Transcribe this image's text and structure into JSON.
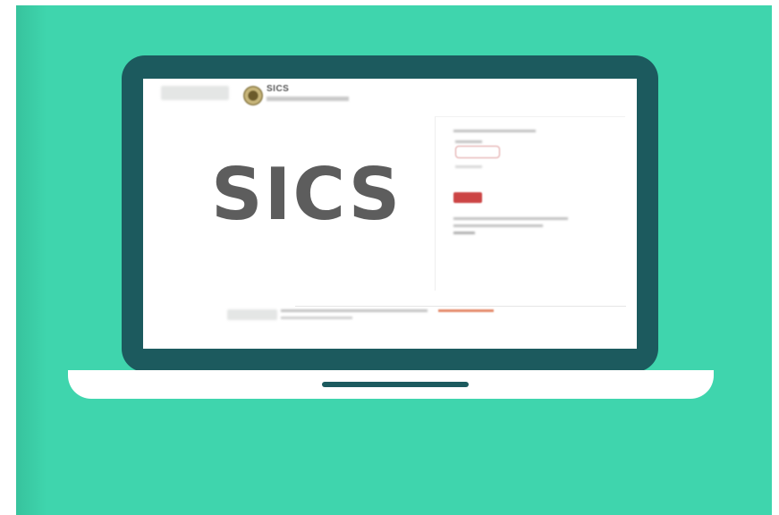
{
  "screen": {
    "header_title": "SICS",
    "logo_text": "SICS"
  },
  "colors": {
    "background": "#3fd5ad",
    "laptop_bezel": "#1c5a5e",
    "laptop_base": "#ffffff",
    "logo_text": "#5d5d5d",
    "login_button": "#cc4444"
  },
  "icons": {
    "header_seal": "emblem-seal-icon",
    "device": "laptop-icon"
  }
}
